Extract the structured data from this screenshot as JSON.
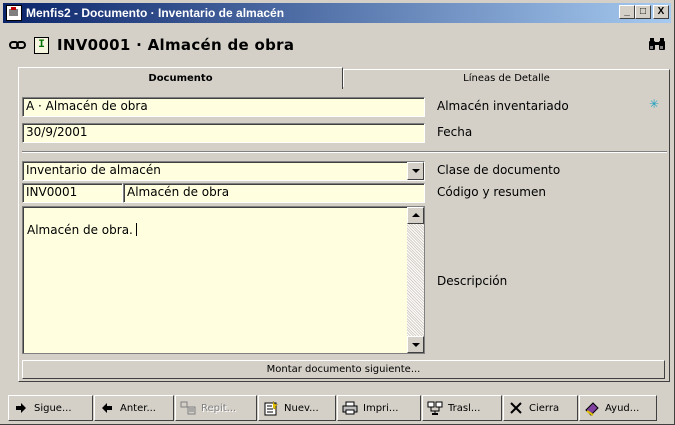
{
  "window": {
    "title": "Menfis2 - Documento · Inventario de almacén",
    "minimize": "_",
    "maximize": "□",
    "close": "X"
  },
  "header": {
    "doc_letter": "I",
    "doc_title": "INV0001 · Almacén de obra"
  },
  "tabs": [
    {
      "label": "Documento",
      "active": true
    },
    {
      "label": "Líneas de Detalle",
      "active": false
    }
  ],
  "form": {
    "almacen": {
      "value": "A · Almacén de obra",
      "label": "Almacén inventariado"
    },
    "fecha": {
      "value": "30/9/2001",
      "label": "Fecha"
    },
    "clase": {
      "value": "Inventario de almacén",
      "label": "Clase de documento"
    },
    "codigo": {
      "code": "INV0001",
      "summary": "Almacén de obra",
      "label": "Código y resumen"
    },
    "descripcion": {
      "value": "Almacén de obra.",
      "label": "Descripción"
    },
    "next_button": "Montar documento siguiente..."
  },
  "toolbar": [
    {
      "label": "Sigue...",
      "icon": "arrow-right-icon",
      "enabled": true
    },
    {
      "label": "Anter...",
      "icon": "arrow-left-icon",
      "enabled": true
    },
    {
      "label": "Repit...",
      "icon": "repeat-icon",
      "enabled": false
    },
    {
      "label": "Nuev...",
      "icon": "new-doc-icon",
      "enabled": true
    },
    {
      "label": "Impri...",
      "icon": "printer-icon",
      "enabled": true
    },
    {
      "label": "Trasl...",
      "icon": "transfer-icon",
      "enabled": true
    },
    {
      "label": "Cierra",
      "icon": "close-x-icon",
      "enabled": true
    },
    {
      "label": "Ayud...",
      "icon": "help-book-icon",
      "enabled": true
    }
  ]
}
